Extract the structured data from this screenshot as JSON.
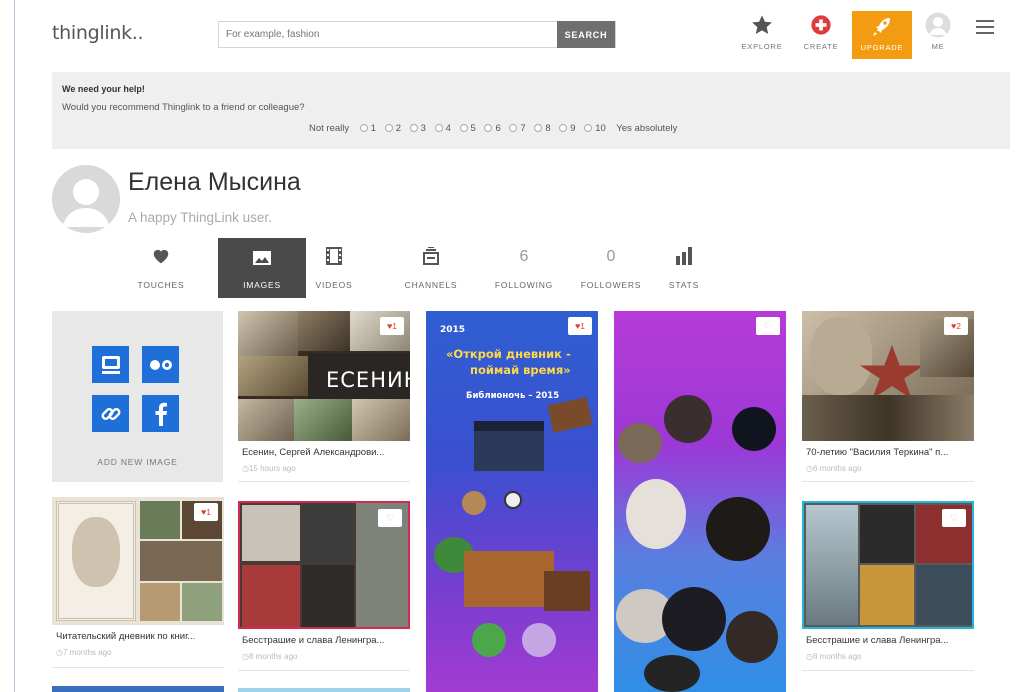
{
  "header": {
    "logo": "thinglink..",
    "search_placeholder": "For example, fashion",
    "search_button": "SEARCH",
    "nav": {
      "explore": "EXPLORE",
      "create": "CREATE",
      "upgrade": "UPGRADE",
      "me": "ME"
    }
  },
  "feedback": {
    "title": "We need your help!",
    "question": "Would you recommend Thinglink to a friend or colleague?",
    "low_label": "Not really",
    "high_label": "Yes absolutely",
    "options": [
      "1",
      "2",
      "3",
      "4",
      "5",
      "6",
      "7",
      "8",
      "9",
      "10"
    ]
  },
  "profile": {
    "name": "Елена Мысина",
    "tagline": "A happy ThingLink user."
  },
  "tabs": {
    "touches": "TOUCHES",
    "images": "IMAGES",
    "videos": "VIDEOS",
    "channels": "CHANNELS",
    "following": "FOLLOWING",
    "following_count": "6",
    "followers": "FOLLOWERS",
    "followers_count": "0",
    "stats": "STATS"
  },
  "add_new_image": "ADD NEW IMAGE",
  "cards": [
    {
      "caption": "Есенин, Сергей Александрови...",
      "time": "15 hours ago",
      "likes": "1",
      "overlay": "ЕСЕНИН"
    },
    {
      "caption": "70-летию \"Василия Теркина\" п...",
      "time": "6 months ago",
      "likes": "2"
    },
    {
      "caption": "Читательский дневник по книг...",
      "time": "7 months ago",
      "likes": "1"
    },
    {
      "caption": "Бесстрашие и слава Ленингра...",
      "time": "8 months ago",
      "likes": ""
    },
    {
      "caption": "Бесстрашие и слава Ленингра...",
      "time": "8 months ago",
      "likes": ""
    }
  ],
  "poster": {
    "likes": "1",
    "year": "2015",
    "title_line1": "«Открой дневник -",
    "title_line2": "поймай время»",
    "subtitle": "Библионочь – 2015"
  },
  "dance_poster": {
    "likes": ""
  },
  "colors": {
    "upgrade": "#f39c12",
    "add_icons": "#1f6fd8",
    "active_tab": "#4a4a4a",
    "feedback_bg": "#efefef",
    "create_red": "#e03a3a"
  }
}
